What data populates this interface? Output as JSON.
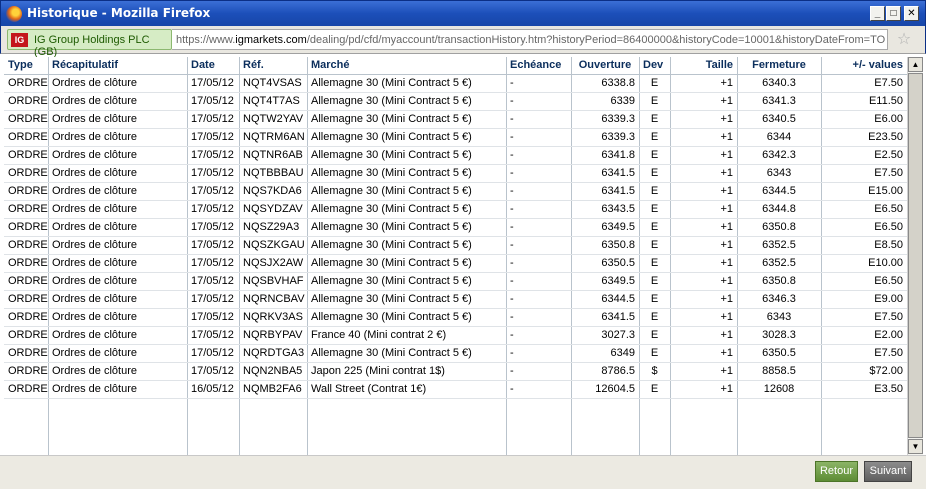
{
  "window": {
    "title": "Historique - Mozilla Firefox"
  },
  "urlbar": {
    "site_logo": "IG",
    "site_identity": "IG Group Holdings PLC (GB)",
    "url_prefix": "https://www.",
    "url_domain": "igmarkets.com",
    "url_rest": "/dealing/pd/cfd/myaccount/transactionHistory.htm?historyPeriod=86400000&historyCode=10001&historyDateFrom=TO"
  },
  "table": {
    "headers": {
      "type": "Type",
      "recap": "Récapitulatif",
      "date": "Date",
      "ref": "Réf.",
      "market": "Marché",
      "expiry": "Echéance",
      "open": "Ouverture",
      "ccy": "Dev",
      "size": "Taille",
      "close": "Fermeture",
      "pnl": "+/- values"
    },
    "rows": [
      {
        "type": "ORDRE",
        "recap": "Ordres de clôture",
        "date": "17/05/12",
        "ref": "NQT4VSAS",
        "market": "Allemagne 30 (Mini Contract 5 €)",
        "expiry": "-",
        "open": "6338.8",
        "ccy": "E",
        "size": "+1",
        "close": "6340.3",
        "pnl": "E7.50"
      },
      {
        "type": "ORDRE",
        "recap": "Ordres de clôture",
        "date": "17/05/12",
        "ref": "NQT4T7AS",
        "market": "Allemagne 30 (Mini Contract 5 €)",
        "expiry": "-",
        "open": "6339",
        "ccy": "E",
        "size": "+1",
        "close": "6341.3",
        "pnl": "E11.50"
      },
      {
        "type": "ORDRE",
        "recap": "Ordres de clôture",
        "date": "17/05/12",
        "ref": "NQTW2YAV",
        "market": "Allemagne 30 (Mini Contract 5 €)",
        "expiry": "-",
        "open": "6339.3",
        "ccy": "E",
        "size": "+1",
        "close": "6340.5",
        "pnl": "E6.00"
      },
      {
        "type": "ORDRE",
        "recap": "Ordres de clôture",
        "date": "17/05/12",
        "ref": "NQTRM6AN",
        "market": "Allemagne 30 (Mini Contract 5 €)",
        "expiry": "-",
        "open": "6339.3",
        "ccy": "E",
        "size": "+1",
        "close": "6344",
        "pnl": "E23.50"
      },
      {
        "type": "ORDRE",
        "recap": "Ordres de clôture",
        "date": "17/05/12",
        "ref": "NQTNR6AB",
        "market": "Allemagne 30 (Mini Contract 5 €)",
        "expiry": "-",
        "open": "6341.8",
        "ccy": "E",
        "size": "+1",
        "close": "6342.3",
        "pnl": "E2.50"
      },
      {
        "type": "ORDRE",
        "recap": "Ordres de clôture",
        "date": "17/05/12",
        "ref": "NQTBBBAU",
        "market": "Allemagne 30 (Mini Contract 5 €)",
        "expiry": "-",
        "open": "6341.5",
        "ccy": "E",
        "size": "+1",
        "close": "6343",
        "pnl": "E7.50"
      },
      {
        "type": "ORDRE",
        "recap": "Ordres de clôture",
        "date": "17/05/12",
        "ref": "NQS7KDA6",
        "market": "Allemagne 30 (Mini Contract 5 €)",
        "expiry": "-",
        "open": "6341.5",
        "ccy": "E",
        "size": "+1",
        "close": "6344.5",
        "pnl": "E15.00"
      },
      {
        "type": "ORDRE",
        "recap": "Ordres de clôture",
        "date": "17/05/12",
        "ref": "NQSYDZAV",
        "market": "Allemagne 30 (Mini Contract 5 €)",
        "expiry": "-",
        "open": "6343.5",
        "ccy": "E",
        "size": "+1",
        "close": "6344.8",
        "pnl": "E6.50"
      },
      {
        "type": "ORDRE",
        "recap": "Ordres de clôture",
        "date": "17/05/12",
        "ref": "NQSZ29A3",
        "market": "Allemagne 30 (Mini Contract 5 €)",
        "expiry": "-",
        "open": "6349.5",
        "ccy": "E",
        "size": "+1",
        "close": "6350.8",
        "pnl": "E6.50"
      },
      {
        "type": "ORDRE",
        "recap": "Ordres de clôture",
        "date": "17/05/12",
        "ref": "NQSZKGAU",
        "market": "Allemagne 30 (Mini Contract 5 €)",
        "expiry": "-",
        "open": "6350.8",
        "ccy": "E",
        "size": "+1",
        "close": "6352.5",
        "pnl": "E8.50"
      },
      {
        "type": "ORDRE",
        "recap": "Ordres de clôture",
        "date": "17/05/12",
        "ref": "NQSJX2AW",
        "market": "Allemagne 30 (Mini Contract 5 €)",
        "expiry": "-",
        "open": "6350.5",
        "ccy": "E",
        "size": "+1",
        "close": "6352.5",
        "pnl": "E10.00"
      },
      {
        "type": "ORDRE",
        "recap": "Ordres de clôture",
        "date": "17/05/12",
        "ref": "NQSBVHAF",
        "market": "Allemagne 30 (Mini Contract 5 €)",
        "expiry": "-",
        "open": "6349.5",
        "ccy": "E",
        "size": "+1",
        "close": "6350.8",
        "pnl": "E6.50"
      },
      {
        "type": "ORDRE",
        "recap": "Ordres de clôture",
        "date": "17/05/12",
        "ref": "NQRNCBAV",
        "market": "Allemagne 30 (Mini Contract 5 €)",
        "expiry": "-",
        "open": "6344.5",
        "ccy": "E",
        "size": "+1",
        "close": "6346.3",
        "pnl": "E9.00"
      },
      {
        "type": "ORDRE",
        "recap": "Ordres de clôture",
        "date": "17/05/12",
        "ref": "NQRKV3AS",
        "market": "Allemagne 30 (Mini Contract 5 €)",
        "expiry": "-",
        "open": "6341.5",
        "ccy": "E",
        "size": "+1",
        "close": "6343",
        "pnl": "E7.50"
      },
      {
        "type": "ORDRE",
        "recap": "Ordres de clôture",
        "date": "17/05/12",
        "ref": "NQRBYPAV",
        "market": "France 40 (Mini contrat 2 €)",
        "expiry": "-",
        "open": "3027.3",
        "ccy": "E",
        "size": "+1",
        "close": "3028.3",
        "pnl": "E2.00"
      },
      {
        "type": "ORDRE",
        "recap": "Ordres de clôture",
        "date": "17/05/12",
        "ref": "NQRDTGA3",
        "market": "Allemagne 30 (Mini Contract 5 €)",
        "expiry": "-",
        "open": "6349",
        "ccy": "E",
        "size": "+1",
        "close": "6350.5",
        "pnl": "E7.50"
      },
      {
        "type": "ORDRE",
        "recap": "Ordres de clôture",
        "date": "17/05/12",
        "ref": "NQN2NBA5",
        "market": "Japon 225 (Mini contrat 1$)",
        "expiry": "-",
        "open": "8786.5",
        "ccy": "$",
        "size": "+1",
        "close": "8858.5",
        "pnl": "$72.00"
      },
      {
        "type": "ORDRE",
        "recap": "Ordres de clôture",
        "date": "16/05/12",
        "ref": "NQMB2FA6",
        "market": "Wall Street (Contrat 1€)",
        "expiry": "-",
        "open": "12604.5",
        "ccy": "E",
        "size": "+1",
        "close": "12608",
        "pnl": "E3.50"
      }
    ]
  },
  "footer": {
    "back_label": "Retour",
    "next_label": "Suivant"
  }
}
